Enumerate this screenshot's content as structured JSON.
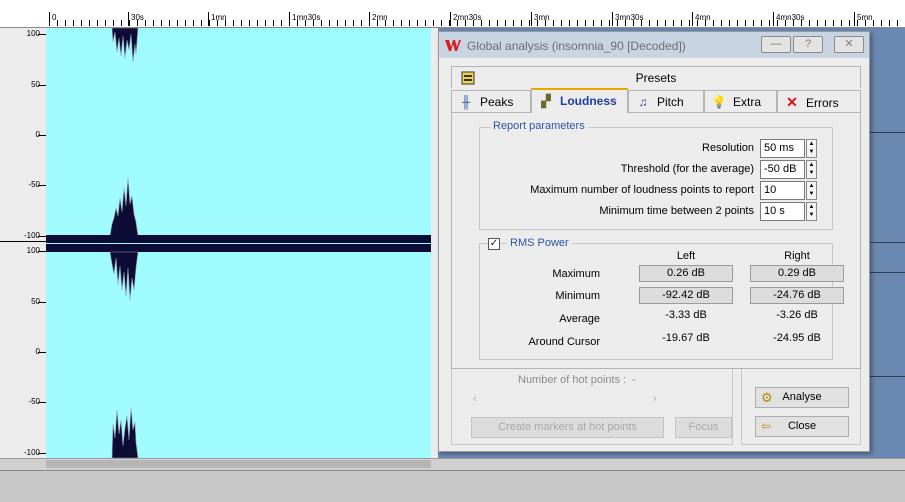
{
  "ruler": {
    "labels": [
      "0",
      "30s",
      "1mn",
      "1mn30s",
      "2mn",
      "2mn30s",
      "3mn",
      "3mn30s",
      "4mn",
      "4mn30s",
      "5mn"
    ]
  },
  "y_axis": {
    "top_channel": [
      "100",
      "50",
      "0",
      "-50",
      "-100"
    ],
    "bottom_channel": [
      "100",
      "50",
      "0",
      "-50",
      "-100"
    ]
  },
  "dialog": {
    "title": "Global analysis (insomnia_90 [Decoded])",
    "tabs": {
      "presets": "Presets",
      "peaks": "Peaks",
      "loudness": "Loudness",
      "pitch": "Pitch",
      "extra": "Extra",
      "errors": "Errors"
    },
    "report_params": {
      "group_label": "Report parameters",
      "resolution_label": "Resolution",
      "resolution_value": "50 ms",
      "threshold_label": "Threshold (for the average)",
      "threshold_value": "-50 dB",
      "max_points_label": "Maximum number of loudness points to report",
      "max_points_value": "10",
      "min_time_label": "Minimum time between 2 points",
      "min_time_value": "10 s"
    },
    "rms": {
      "label": "RMS Power",
      "checked": true,
      "col_left": "Left",
      "col_right": "Right",
      "rows": [
        {
          "label": "Maximum",
          "left": "0.26 dB",
          "right": "0.29 dB"
        },
        {
          "label": "Minimum",
          "left": "-92.42 dB",
          "right": "-24.76 dB"
        },
        {
          "label": "Average",
          "left": "-3.33 dB",
          "right": "-3.26 dB"
        },
        {
          "label": "Around Cursor",
          "left": "-19.67 dB",
          "right": "-24.95 dB"
        }
      ]
    },
    "hot_points": {
      "label": "Number of hot points :",
      "value": "-"
    },
    "buttons": {
      "create_markers": "Create markers at hot points",
      "focus": "Focus",
      "analyse": "Analyse",
      "close": "Close"
    }
  },
  "colors": {
    "waveform_bg": "#9ffbfd",
    "waveform": "#0d0c35",
    "accent_label": "#2e55a8",
    "desktop": "#6b88b3"
  }
}
